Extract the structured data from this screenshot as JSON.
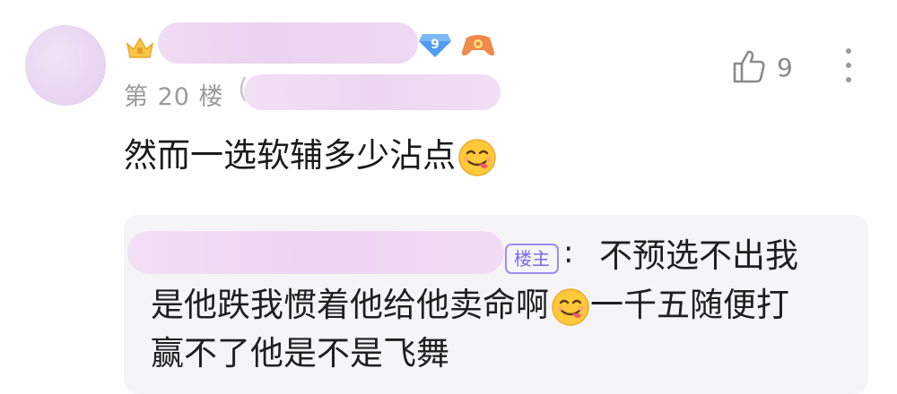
{
  "comment": {
    "floor": "第 20 楼",
    "like_count": "9",
    "level": "9",
    "text": "然而一选软辅多少沾点"
  },
  "reply": {
    "op_badge": "楼主",
    "colon": ":",
    "line1": "不预选不出我",
    "line2_before": "是他跌我惯着他给他卖命啊",
    "line2_after": "一千五随便打",
    "line3": "赢不了他是不是飞舞"
  },
  "icons": {
    "like": "thumbs-up-icon",
    "more": "more-vertical-icon",
    "emoji": "yum-emoji-icon",
    "crown": "crown-icon",
    "level_badge": "diamond-level-icon",
    "game_badge": "gamepad-icon"
  },
  "colors": {
    "op_badge": "#7b6ae8",
    "floor_text": "#9a9a9a",
    "reply_bg": "#f5f5f7"
  }
}
